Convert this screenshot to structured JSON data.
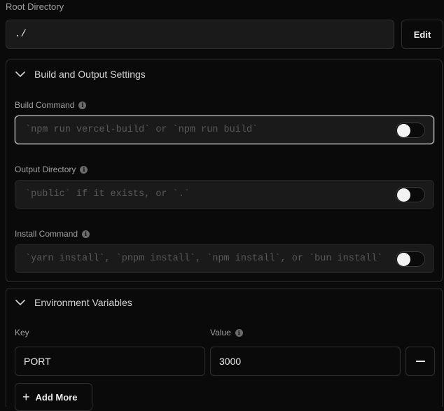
{
  "root": {
    "label": "Root Directory",
    "value": "./",
    "edit_label": "Edit"
  },
  "build": {
    "title": "Build and Output Settings",
    "fields": [
      {
        "label": "Build Command",
        "placeholder": "`npm run vercel-build` or `npm run build`",
        "override": false
      },
      {
        "label": "Output Directory",
        "placeholder": "`public` if it exists, or `.`",
        "override": false
      },
      {
        "label": "Install Command",
        "placeholder": "`yarn install`, `pnpm install`, `npm install`, or `bun install`",
        "override": false
      }
    ]
  },
  "env": {
    "title": "Environment Variables",
    "key_label": "Key",
    "value_label": "Value",
    "key_value": "PORT",
    "value_value": "3000",
    "add_label": "Add More"
  },
  "icons": {
    "chevron": "chevron-down-icon",
    "info": "info-icon",
    "minus": "minus-icon",
    "plus": "plus-icon"
  }
}
